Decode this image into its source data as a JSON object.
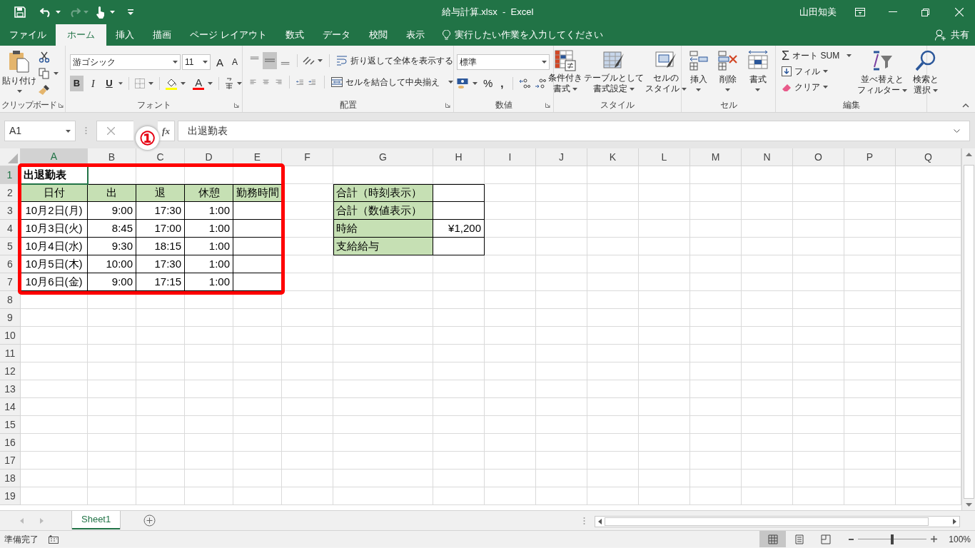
{
  "window": {
    "title": "給与計算.xlsx  -  Excel",
    "user": "山田知美"
  },
  "tabs": [
    {
      "label": "ファイル",
      "selected": false
    },
    {
      "label": "ホーム",
      "selected": true
    },
    {
      "label": "挿入",
      "selected": false
    },
    {
      "label": "描画",
      "selected": false
    },
    {
      "label": "ページ レイアウト",
      "selected": false
    },
    {
      "label": "数式",
      "selected": false
    },
    {
      "label": "データ",
      "selected": false
    },
    {
      "label": "校閲",
      "selected": false
    },
    {
      "label": "表示",
      "selected": false
    }
  ],
  "tell_me": {
    "placeholder": "実行したい作業を入力してください"
  },
  "share": "共有",
  "ribbon": {
    "clipboard": {
      "paste": "貼り付け",
      "label": "クリップボード"
    },
    "font": {
      "name": "游ゴシック",
      "size": "11",
      "grow": "A",
      "shrink": "A",
      "bold_button": "B",
      "italic_button": "I",
      "underline_button": "U",
      "font_color": "A",
      "bold": true,
      "label": "フォント"
    },
    "alignment": {
      "vertical_middle": true,
      "wrap": "折り返して全体を表示する",
      "merge": "セルを結合して中央揃え",
      "label": "配置"
    },
    "number": {
      "format": "標準",
      "percent": "%",
      "comma": ",",
      "label": "数値"
    },
    "styles": {
      "conditional": [
        "条件付き",
        "書式"
      ],
      "table": [
        "テーブルとして",
        "書式設定"
      ],
      "cell_styles": [
        "セルの",
        "スタイル"
      ],
      "label": "スタイル"
    },
    "cells": {
      "insert": "挿入",
      "delete": "削除",
      "format": "書式",
      "label": "セル"
    },
    "editing": {
      "autosum_icon": "Σ",
      "autosum": "オート SUM",
      "fill": "フィル",
      "clear": "クリア",
      "sort": [
        "並べ替えと",
        "フィルター"
      ],
      "find": [
        "検索と",
        "選択"
      ],
      "label": "編集"
    }
  },
  "name_box": "A1",
  "function_button": "fx",
  "formula": "出退勤表",
  "sheet": {
    "columns": [
      "A",
      "B",
      "C",
      "D",
      "E",
      "F",
      "G",
      "H",
      "I",
      "J",
      "K",
      "L",
      "M",
      "N",
      "O",
      "P",
      "Q"
    ],
    "rows": [
      "1",
      "2",
      "3",
      "4",
      "5",
      "6",
      "7",
      "8",
      "9",
      "10",
      "11",
      "12",
      "13",
      "14",
      "15",
      "16",
      "17",
      "18",
      "19"
    ],
    "title": "出退勤表",
    "attendance_table": {
      "columns": [
        "日付",
        "出",
        "退",
        "休憩",
        "勤務時間"
      ],
      "rows": [
        [
          "10月2日(月)",
          "9:00",
          "17:30",
          "1:00"
        ],
        [
          "10月3日(火)",
          "8:45",
          "17:00",
          "1:00"
        ],
        [
          "10月4日(水)",
          "9:30",
          "18:15",
          "1:00"
        ],
        [
          "10月5日(木)",
          "10:00",
          "17:30",
          "1:00"
        ],
        [
          "10月6日(金)",
          "9:00",
          "17:15",
          "1:00"
        ]
      ]
    },
    "summary_table": {
      "rows": [
        {
          "label": "合計（時刻表示）"
        },
        {
          "label": "合計（数値表示）"
        },
        {
          "label": "時給",
          "value": "¥1,200"
        },
        {
          "label": "支給給与"
        }
      ]
    }
  },
  "annotation": {
    "marker": "①"
  },
  "sheet_tabs": [
    {
      "label": "Sheet1",
      "selected": true
    }
  ],
  "status_bar": {
    "status": "準備完了",
    "view_modes": [
      {
        "selected": true
      },
      {
        "selected": false
      },
      {
        "selected": false
      }
    ],
    "zoom": {
      "level": 0.5
    },
    "zoom_text": "100%"
  }
}
